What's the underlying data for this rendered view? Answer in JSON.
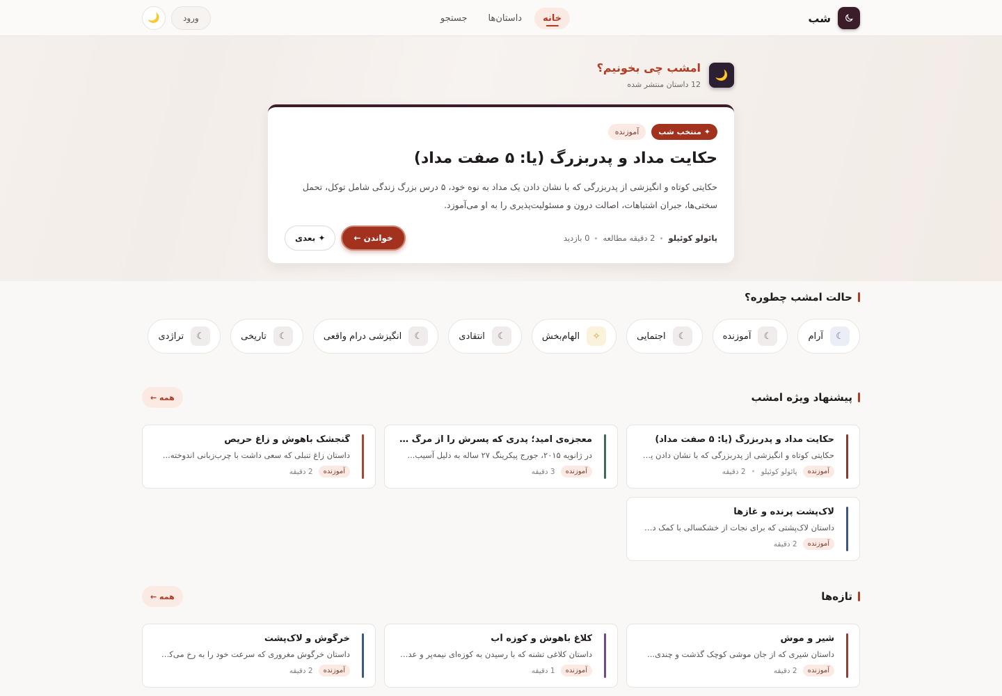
{
  "header": {
    "brand": "شب",
    "nav": [
      "خانه",
      "داستان‌ها",
      "جستجو"
    ],
    "login": "ورود",
    "theme_icon": "moon-icon"
  },
  "hero": {
    "title": "امشب چی بخونیم؟",
    "subtitle": "12 داستان منتشر شده",
    "feature": {
      "badge_primary": "✦ منتخب شب",
      "badge_tag": "آموزنده",
      "title": "حکایت مداد و پدربزرگ (یا: ۵ صفت مداد)",
      "desc": "حکایتی کوتاه و انگیزشی از پدربزرگی که با نشان دادن یک مداد به نوه خود، ۵ درس بزرگ زندگی شامل توکل، تحمل سختی‌ها، جبران اشتباهات، اصالت درون و مسئولیت‌پذیری را به او می‌آموزد.",
      "author": "پائولو کوئیلو",
      "read_time": "2 دقیقه مطالعه",
      "views": "0 بازدید",
      "read_btn": "خواندن ←",
      "next_btn": "✦ بعدی"
    }
  },
  "moods": {
    "title": "حالت امشب چطوره؟",
    "items": [
      {
        "label": "آرام",
        "icon": "☾"
      },
      {
        "label": "آموزنده",
        "icon": "☾"
      },
      {
        "label": "اجتمایی",
        "icon": "☾"
      },
      {
        "label": "الهام‌بخش",
        "icon": "✧"
      },
      {
        "label": "انتقادی",
        "icon": "☾"
      },
      {
        "label": "انگیزشی درام واقعی",
        "icon": "☾"
      },
      {
        "label": "تاریخی",
        "icon": "☾"
      },
      {
        "label": "تراژدی",
        "icon": "☾"
      }
    ]
  },
  "recommended": {
    "title": "پیشنهاد ویژه امشب",
    "all_btn": "همه ←",
    "cards": [
      {
        "title": "حکایت مداد و پدربزرگ (یا: ۵ صفت مداد)",
        "desc": "حکایتی کوتاه و انگیزشی از پدربزرگی که با نشان دادن یک...",
        "tag": "آموزنده",
        "author": "پائولو کوئیلو",
        "time": "2 دقیقه",
        "color": "#8a3b30"
      },
      {
        "title": "معجزه‌ی امید؛ پدری که پسرش را از مرگ حتمی ن...",
        "desc": "در ژانویه ۲۰۱۵، جورج پیکرینگ ۲۷ ساله به دلیل آسیب...",
        "tag": "آموزنده",
        "author": "",
        "time": "3 دقیقه",
        "color": "#3d6b55"
      },
      {
        "title": "گنجشک باهوش و زاغ حریص",
        "desc": "داستان زاغ تنبلی که سعی داشت با چرب‌زبانی اندوخته...",
        "tag": "آموزنده",
        "author": "",
        "time": "2 دقیقه",
        "color": "#9b4a34"
      },
      {
        "title": "لاک‌پشت پرنده و غازها",
        "desc": "داستان لاک‌پشتی که برای نجات از خشکسالی با کمک دو...",
        "tag": "آموزنده",
        "author": "",
        "time": "2 دقیقه",
        "color": "#3e5682"
      }
    ]
  },
  "recent": {
    "title": "تازه‌ها",
    "all_btn": "همه ←",
    "cards": [
      {
        "title": "شیر و موش",
        "desc": "داستان شیری که از جان موشی کوچک گذشت و چندی...",
        "tag": "آموزنده",
        "time": "2 دقیقه",
        "color": "#8f4030"
      },
      {
        "title": "کلاغ باهوش و کوزه آب",
        "desc": "داستان کلاغی تشنه که با رسیدن به کوزه‌ای نیمه‌پر و عدم...",
        "tag": "آموزنده",
        "time": "1 دقیقه",
        "color": "#6a4c86"
      },
      {
        "title": "خرگوش و لاک‌پشت",
        "desc": "داستان خرگوش مغروری که سرعت خود را به رخ می‌کشی...",
        "tag": "آموزنده",
        "time": "2 دقیقه",
        "color": "#3e5682"
      }
    ]
  }
}
